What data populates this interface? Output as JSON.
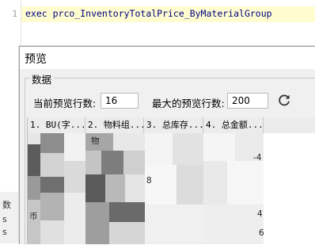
{
  "editor": {
    "line_number": "1",
    "code": "exec prco_InventoryTotalPrice_ByMaterialGroup",
    "bottom_fragments": [
      "数",
      "s",
      "s"
    ]
  },
  "dialog": {
    "title": "预览",
    "group_label": "数据",
    "current_rows_label": "当前预览行数:",
    "current_rows_value": "16",
    "max_rows_label": "最大的预览行数:",
    "max_rows_value": "200",
    "refresh_icon": "refresh-icon"
  },
  "grid": {
    "columns": [
      "1. BU(字...",
      "2. 物料组...",
      "3. 总库存...",
      "4. 总金额..."
    ],
    "visible_fragments": [
      "物",
      "-4",
      "8",
      "币",
      "4",
      "6"
    ]
  },
  "colors": {
    "code_highlight": "#fffdd0",
    "code_text": "#000080",
    "dialog_bg": "#f0f0f0",
    "grid_header_bg": "#ececec",
    "refresh_icon": "#333333"
  }
}
